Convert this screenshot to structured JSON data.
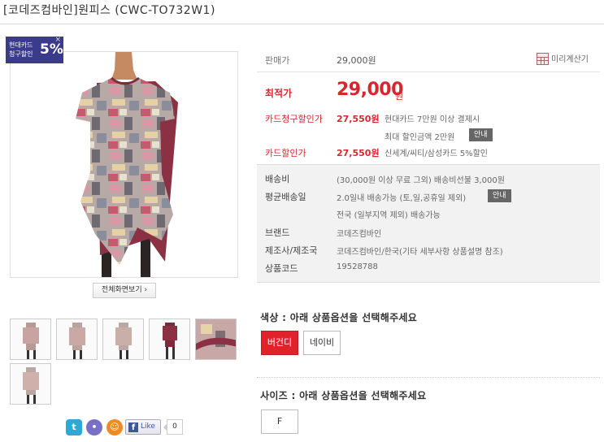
{
  "product": {
    "title": "[코데즈컴바인]원피스 (CWC-TO732W1)",
    "card_badge": {
      "text": "현대카드 청구할인",
      "percent": "5%",
      "close": "×"
    },
    "fullview_label": "전체화면보기 ›"
  },
  "price": {
    "list_label": "판매가",
    "list_value": "29,000원",
    "calc_label": "미리계산기",
    "best_label": "최적가",
    "best_value": "29,000",
    "best_unit": "원",
    "card_claim_label": "카드청구할인가",
    "card_claim_value": "27,550원",
    "card_claim_desc1": "현대카드 7만원 이상 결제시",
    "card_claim_desc2": "최대 할인금액 2만원",
    "info_label": "안내",
    "card_disc_label": "카드할인가",
    "card_disc_value": "27,550원",
    "card_disc_desc": "신세계/씨티/삼성카드 5%할인"
  },
  "shipping": {
    "fee_label": "배송비",
    "fee_value": "(30,000원 이상 무료 그외) 배송비선불 3,000원",
    "avg_label": "평균배송일",
    "avg_value": "2.0일내 배송가능 (토,일,공휴일 제외)",
    "info_label": "안내",
    "avg_value2": "전국 (일부지역 제외) 배송가능",
    "brand_label": "브랜드",
    "brand_value": "코데즈컴바인",
    "maker_label": "제조사/제조국",
    "maker_value": "코데즈컴바인/한국(기타 세부사항 상품설명 참조)",
    "code_label": "상품코드",
    "code_value": "19528788"
  },
  "options": {
    "color_title": "색상 : 아래 상품옵션을 선택해주세요",
    "colors": [
      "버건디",
      "네이비"
    ],
    "selected_color": "버건디",
    "size_title": "사이즈 : 아래 상품옵션을 선택해주세요",
    "sizes": [
      "F"
    ]
  },
  "social": {
    "like_label": "Like",
    "like_count": "0",
    "icons": [
      "twitter-icon",
      "me2day-icon",
      "yozm-icon"
    ]
  },
  "colors": {
    "accent_red": "#d6272e",
    "badge_navy": "#3b3b8c"
  }
}
